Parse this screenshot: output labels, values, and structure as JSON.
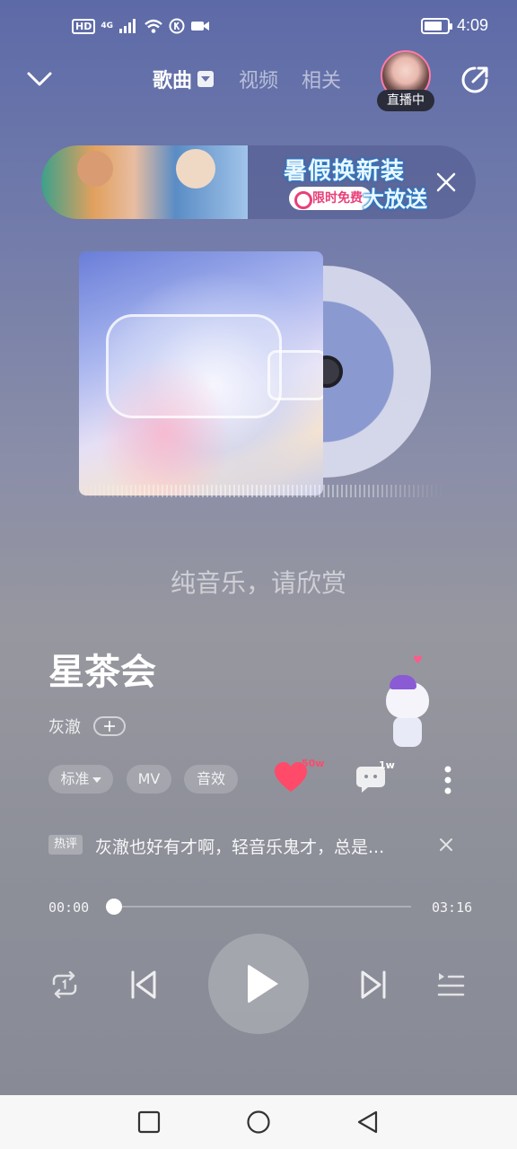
{
  "status_bar": {
    "hd": "HD",
    "network": "4G",
    "time": "4:09",
    "battery_level": 0.8
  },
  "header": {
    "tabs": [
      {
        "label": "歌曲",
        "active": true
      },
      {
        "label": "视频",
        "active": false
      },
      {
        "label": "相关",
        "active": false
      }
    ],
    "live_badge": "直播中"
  },
  "banner": {
    "title": "暑假换新装",
    "subtitle": "大放送",
    "chip": "限时免费"
  },
  "player": {
    "lyric": "纯音乐，请欣赏",
    "song_title": "星茶会",
    "artist": "灰澈",
    "chips": [
      "标准",
      "MV",
      "音效"
    ],
    "like_count": "50w",
    "comment_count": "1w",
    "hot_comment_tag": "热评",
    "hot_comment": "灰澈也好有才啊，轻音乐鬼才，总是...",
    "time_current": "00:00",
    "time_total": "03:16",
    "progress": 0.0
  },
  "colors": {
    "accent_like": "#ff4a6a",
    "banner_text_outline": "#1d7fd2"
  }
}
